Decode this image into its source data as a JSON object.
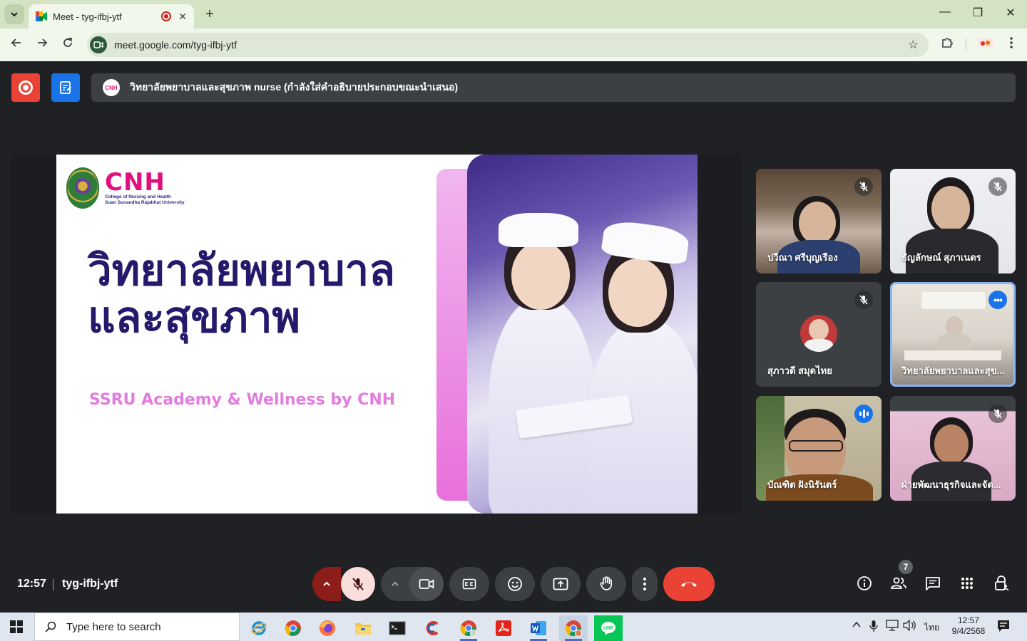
{
  "browser": {
    "tab_title": "Meet - tyg-ifbj-ytf",
    "tab_close": "✕",
    "new_tab": "+",
    "url": "meet.google.com/tyg-ifbj-ytf",
    "window_controls": {
      "minimize": "—",
      "maximize": "❐",
      "close": "✕"
    }
  },
  "meet": {
    "presentation_banner": "วิทยาลัยพยาบาลและสุขภาพ nurse (กำลังใส่คำอธิบายประกอบขณะนำเสนอ)",
    "presenter_avatar": "CNH",
    "slide": {
      "logo": "CNH",
      "logo_line1": "College of Nursing and Health",
      "logo_line2": "Suan Sunandha Rajabhat University",
      "title_line1": "วิทยาลัยพยาบาล",
      "title_line2": "และสุขภาพ",
      "subtitle": "SSRU Academy & Wellness by CNH"
    },
    "participants": [
      {
        "name": "ปวีณา ศรีบุญเรือง",
        "mic": "muted"
      },
      {
        "name": "ธัญลักษณ์ สุภาเนตร",
        "mic": "muted"
      },
      {
        "name": "สุภาวดี สมุดไทย",
        "mic": "muted"
      },
      {
        "name": "วิทยาลัยพยาบาลและสุข...",
        "mic": "options"
      },
      {
        "name": "บัณฑิต ฝังนิรันดร์",
        "mic": "speaking"
      },
      {
        "name": "ฝ่ายพัฒนาธุรกิจและจัด...",
        "mic": "muted"
      }
    ],
    "bottom": {
      "time": "12:57",
      "meeting_code": "tyg-ifbj-ytf",
      "participant_count": "7"
    },
    "colors": {
      "end_call": "#ea4335",
      "mic_muted_bg": "#f9dedc",
      "accent": "#1a73e8"
    }
  },
  "taskbar": {
    "search_placeholder": "Type here to search",
    "language": "ไทย",
    "time": "12:57",
    "date": "9/4/2568"
  }
}
